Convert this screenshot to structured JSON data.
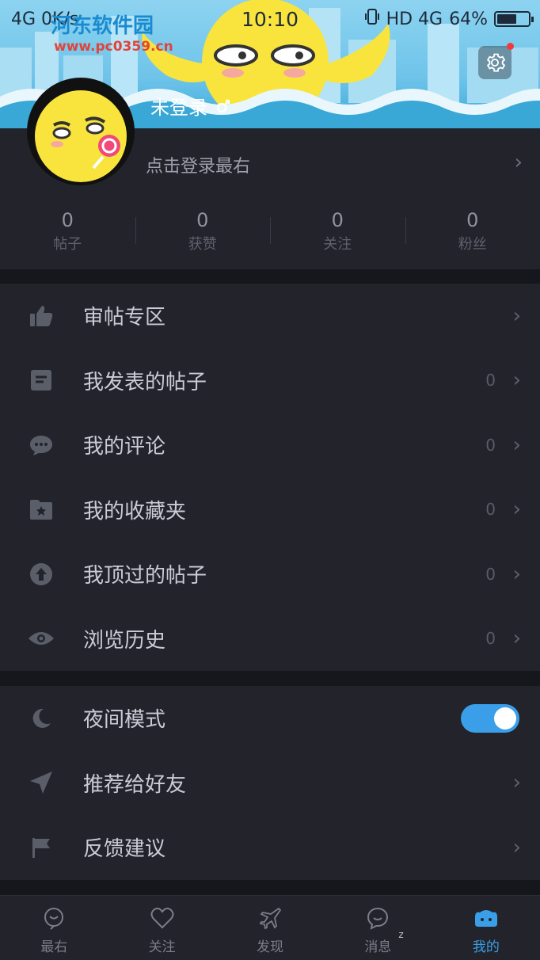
{
  "status_bar": {
    "network": "4G 0K/s",
    "time": "10:10",
    "indicators": "HD 4G",
    "battery_percent": "64%",
    "battery_level": 0.64
  },
  "watermark": {
    "site_name": "河东软件园",
    "url": "www.pc0359.cn"
  },
  "header": {
    "login_state": "未登录",
    "settings_icon": "gear-icon",
    "gender_icon": "male-symbol-icon"
  },
  "profile": {
    "login_prompt": "点击登录最右",
    "stats": [
      {
        "value": "0",
        "label": "帖子"
      },
      {
        "value": "0",
        "label": "获赞"
      },
      {
        "value": "0",
        "label": "关注"
      },
      {
        "value": "0",
        "label": "粉丝"
      }
    ]
  },
  "menu_primary": [
    {
      "icon": "thumbs-up-icon",
      "label": "审帖专区",
      "count": ""
    },
    {
      "icon": "post-icon",
      "label": "我发表的帖子",
      "count": "0"
    },
    {
      "icon": "comment-icon",
      "label": "我的评论",
      "count": "0"
    },
    {
      "icon": "favorite-folder-icon",
      "label": "我的收藏夹",
      "count": "0"
    },
    {
      "icon": "upvote-icon",
      "label": "我顶过的帖子",
      "count": "0"
    },
    {
      "icon": "eye-icon",
      "label": "浏览历史",
      "count": "0"
    }
  ],
  "menu_secondary": [
    {
      "icon": "moon-icon",
      "label": "夜间模式",
      "toggle_on": true
    },
    {
      "icon": "send-icon",
      "label": "推荐给好友"
    },
    {
      "icon": "flag-icon",
      "label": "反馈建议"
    }
  ],
  "tabbar": [
    {
      "icon": "home-icon",
      "label": "最右"
    },
    {
      "icon": "heart-icon",
      "label": "关注"
    },
    {
      "icon": "discover-icon",
      "label": "发现"
    },
    {
      "icon": "message-icon",
      "label": "消息",
      "badge": "z"
    },
    {
      "icon": "profile-icon",
      "label": "我的",
      "active": true
    }
  ],
  "colors": {
    "accent": "#3a9fe8",
    "background": "#16171c",
    "panel": "#22232b",
    "banner": "#6fc4ea"
  }
}
